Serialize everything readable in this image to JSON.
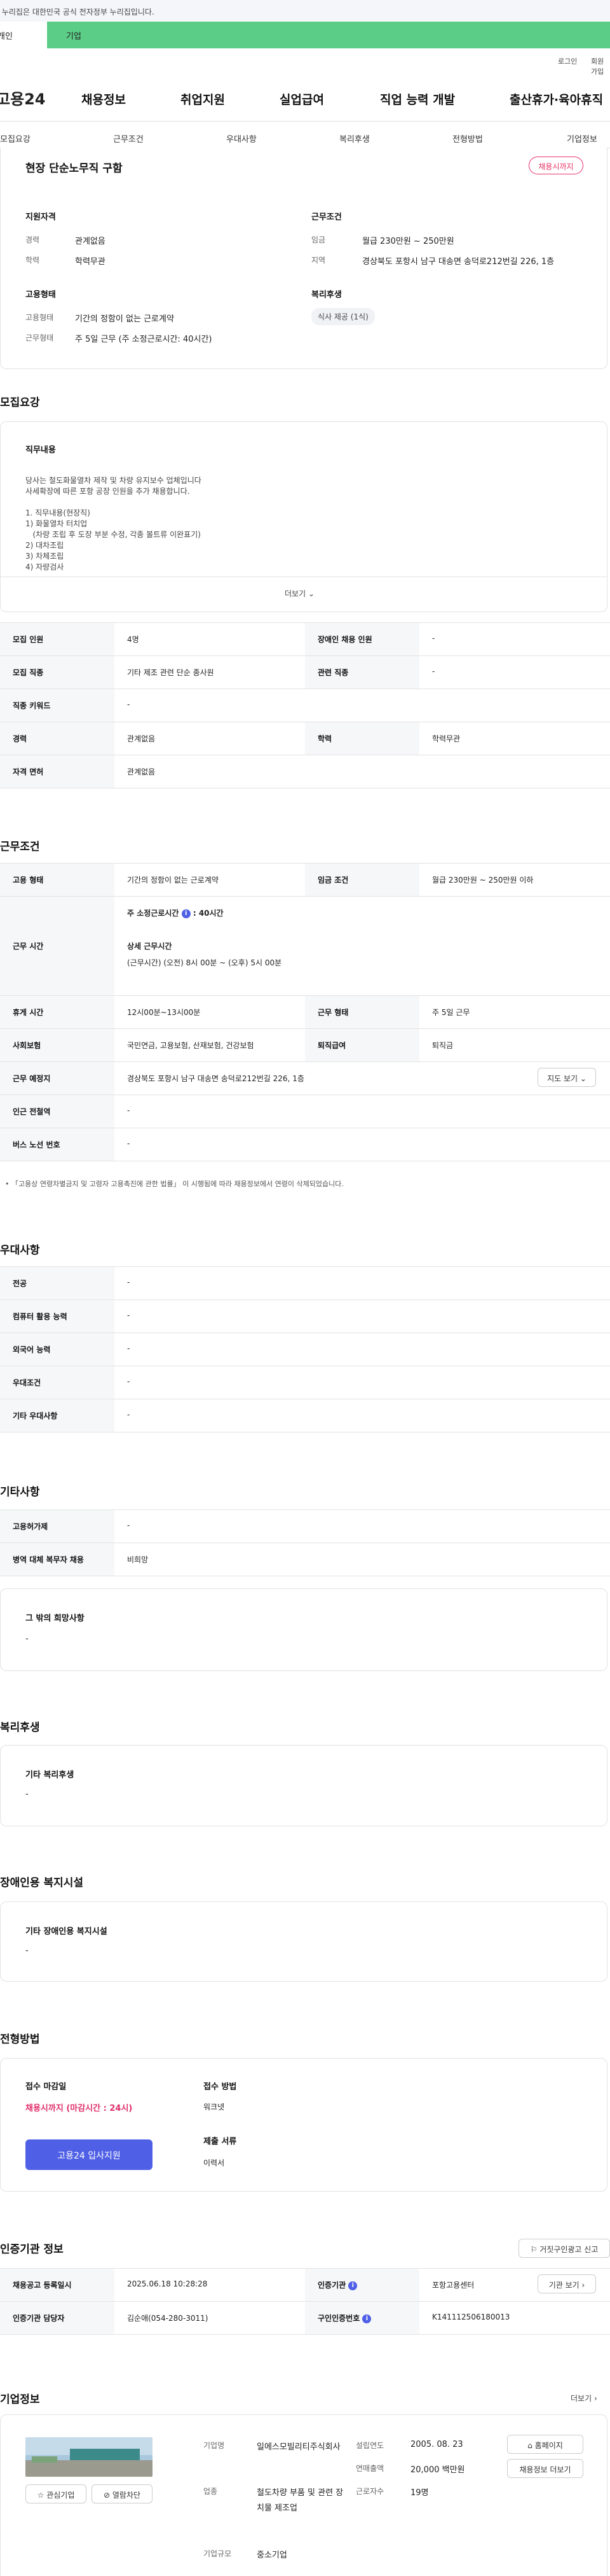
{
  "gov_banner": "이 누리집은 대한민국 공식 전자정부 누리집입니다.",
  "top_tabs": [
    "개인",
    "기업"
  ],
  "util": {
    "login": "로그인",
    "join": "회원가입"
  },
  "logo": "고용24",
  "gnb": [
    "채용정보",
    "취업지원",
    "실업급여",
    "직업 능력 개발",
    "출산휴가·육아휴직"
  ],
  "subnav": [
    "모집요강",
    "근무조건",
    "우대사항",
    "복리후생",
    "전형방법",
    "기업정보"
  ],
  "summary": {
    "title": "현장 단순노무직 구함",
    "badge": "채용시까지",
    "qual_title": "지원자격",
    "career_l": "경력",
    "career_v": "관계없음",
    "edu_l": "학력",
    "edu_v": "학력무관",
    "cond_title": "근무조건",
    "wage_l": "임금",
    "wage_v": "월급 230만원 ~ 250만원",
    "area_l": "지역",
    "area_v": "경상북도 포항시 남구 대송면 송덕로212번길 226, 1층",
    "emp_title": "고용형태",
    "etype_l": "고용형태",
    "etype_v": "기간의 정함이 없는 근로계약",
    "wtype_l": "근무형태",
    "wtype_v": "주 5일 근무 (주 소정근로시간: 40시간)",
    "welfare_title": "복리후생",
    "welfare_chip": "식사 제공 (1식)"
  },
  "recruit": {
    "title": "모집요강",
    "duty_title": "직무내용",
    "duty_lines": [
      "당사는 철도화물열차 제작 및 차량 유지보수 업체입니다",
      "사세확장에 따른 포항 공장 인원을 추가 채용합니다.",
      "",
      "1. 직무내용(현장직)",
      "1) 화물열차 터치업",
      "   (차량 조립 후 도장 부분 수정, 각종 볼트류 이완표기)",
      "2) 대차조립",
      "3) 차체조립",
      "4) 자량검사"
    ],
    "more": "더보기",
    "rows": [
      [
        "모집 인원",
        "4명",
        "장애인 채용 인원",
        "-"
      ],
      [
        "모집 직종",
        "기타 제조 관련 단순 종사원",
        "관련 직종",
        "-"
      ],
      [
        "직종 키워드",
        "-",
        "",
        ""
      ],
      [
        "경력",
        "관계없음",
        "학력",
        "학력무관"
      ],
      [
        "자격 면허",
        "관계없음",
        "",
        ""
      ]
    ]
  },
  "work": {
    "title": "근무조건",
    "emp_l": "고용 형태",
    "emp_v": "기간의 정함이 없는 근로계약",
    "wage_l": "임금 조건",
    "wage_v": "월급 230만원 ~ 250만원 이하",
    "time_l": "근무 시간",
    "time_week": "주 소정근로시간",
    "time_week_v": ": 40시간",
    "time_detail_t": "상세 근무시간",
    "time_detail_v": "(근무시간) (오전) 8시 00분 ~ (오후) 5시 00분",
    "rest_l": "휴게 시간",
    "rest_v": "12시00분~13시00분",
    "form_l": "근무 형태",
    "form_v": "주 5일 근무",
    "ins_l": "사회보험",
    "ins_v": "국민연금, 고용보험, 산재보험, 건강보험",
    "sev_l": "퇴직급여",
    "sev_v": "퇴직금",
    "place_l": "근무 예정지",
    "place_v": "경상북도 포항시 남구 대송면 송덕로212번길 226, 1층",
    "map_btn": "지도 보기",
    "subway_l": "인근 전철역",
    "subway_v": "-",
    "bus_l": "버스 노선 번호",
    "bus_v": "-",
    "note": "「고용상 연령차별금지 및 고령자 고용촉진에 관한 법률」 이 시행됨에 따라 채용정보에서 연령이 삭제되었습니다."
  },
  "pref": {
    "title": "우대사항",
    "rows": [
      [
        "전공",
        "-"
      ],
      [
        "컴퓨터 활용 능력",
        "-"
      ],
      [
        "외국어 능력",
        "-"
      ],
      [
        "우대조건",
        "-"
      ],
      [
        "기타 우대사항",
        "-"
      ]
    ]
  },
  "etc": {
    "title": "기타사항",
    "rows": [
      [
        "고용허가제",
        "-"
      ],
      [
        "병역 대체 복무자 채용",
        "비희망"
      ]
    ],
    "box_title": "그 밖의 희망사항",
    "box_val": "-"
  },
  "welfare": {
    "title": "복리후생",
    "box_title": "기타 복리후생",
    "box_val": "-"
  },
  "disab": {
    "title": "장애인용 복지시설",
    "box_title": "기타 장애인용 복지시설",
    "box_val": "-"
  },
  "process": {
    "title": "전형방법",
    "deadline_t": "접수 마감일",
    "deadline_v": "채용시까지 (마감시간 : 24시)",
    "apply_btn": "고용24 입사지원",
    "method_t": "접수 방법",
    "method_v": "워크넷",
    "docs_t": "제출 서류",
    "docs_v": "이력서"
  },
  "cert": {
    "title": "인증기관 정보",
    "report_btn": "거짓구인광고 신고",
    "reg_l": "채용공고 등록일시",
    "reg_v": "2025.06.18 10:28:28",
    "org_l": "인증기관",
    "org_v": "포항고용센터",
    "go_btn": "기관 보기",
    "mgr_l": "인증기관 담당자",
    "mgr_v": "김순애(054-280-3011)",
    "no_l": "구인인증번호",
    "no_v": "K141112506180013"
  },
  "company": {
    "title": "기업정보",
    "more": "더보기",
    "fav_btn": "관심기업",
    "block_btn": "열람차단",
    "name_l": "기업명",
    "name_v": "일에스모빌리티주식회사",
    "ind_l": "업종",
    "ind_v": "철도차량 부품 및 관련 장치물 제조업",
    "size_l": "기업규모",
    "size_v": "중소기업",
    "est_l": "설립연도",
    "est_v": "2005. 08. 23",
    "sales_l": "연매출액",
    "sales_v": "20,000 백만원",
    "emp_l": "근로자수",
    "emp_v": "19명",
    "home_btn": "홈페이지",
    "list_btn": "채용정보 더보기"
  }
}
